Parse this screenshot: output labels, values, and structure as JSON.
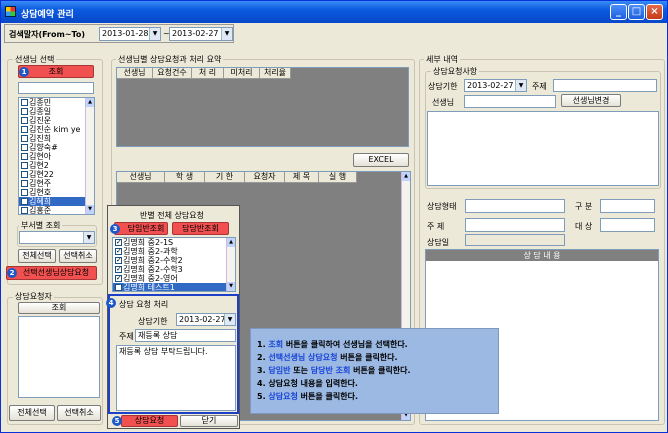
{
  "window": {
    "title": "상담예약 관리"
  },
  "search": {
    "label": "검색말자(From~To)",
    "from": "2013-01-28",
    "sep": "~",
    "to": "2013-02-27"
  },
  "teacher_select": {
    "title": "선생님 선택",
    "query_button": "조회",
    "teachers": [
      {
        "name": "김종민",
        "checked": false,
        "selected": false
      },
      {
        "name": "김종일",
        "checked": false,
        "selected": false
      },
      {
        "name": "김진운",
        "checked": false,
        "selected": false
      },
      {
        "name": "김진순 kim ye",
        "checked": false,
        "selected": false
      },
      {
        "name": "김진희",
        "checked": false,
        "selected": false
      },
      {
        "name": "김향숙#",
        "checked": false,
        "selected": false
      },
      {
        "name": "김현아",
        "checked": false,
        "selected": false
      },
      {
        "name": "김현2",
        "checked": false,
        "selected": false
      },
      {
        "name": "김현22",
        "checked": false,
        "selected": false
      },
      {
        "name": "김현주",
        "checked": false,
        "selected": false
      },
      {
        "name": "김현호",
        "checked": false,
        "selected": false
      },
      {
        "name": "김혜희",
        "checked": true,
        "selected": true
      },
      {
        "name": "김홍준",
        "checked": false,
        "selected": false
      }
    ],
    "dept_label": "부서별 조회",
    "select_all": "전체선택",
    "deselect_all": "선택취소",
    "request_button": "선택선생님상담요청"
  },
  "requester": {
    "title": "상담요청자",
    "query_button": "조회",
    "select_all": "전체선택",
    "deselect_all": "선택취소"
  },
  "summary": {
    "title": "선생님별 상담요청과 처리 요약",
    "columns": [
      "선생님",
      "요청건수",
      "처 리",
      "미처리",
      "처리율"
    ],
    "excel_button": "EXCEL",
    "detail_columns": [
      "선생님",
      "학 생",
      "기 한",
      "요청자",
      "제 목",
      "실 행"
    ]
  },
  "class_popup": {
    "title": "반별 전체 상담요청",
    "tab_homeroom": "담임반조회",
    "tab_subject": "담당반조회",
    "classes": [
      {
        "name": "김명희 중2-1S",
        "checked": true,
        "selected": false
      },
      {
        "name": "김명희 중2-과학",
        "checked": true,
        "selected": false
      },
      {
        "name": "김명희 중2-수학2",
        "checked": true,
        "selected": false
      },
      {
        "name": "김명희 중2-수학3",
        "checked": true,
        "selected": false
      },
      {
        "name": "김명희 중2-영어",
        "checked": true,
        "selected": false
      },
      {
        "name": "김명희 테스트1",
        "checked": true,
        "selected": true
      }
    ],
    "process_title": "상담 요청 처리",
    "deadline_label": "상담기한",
    "deadline_value": "2013-02-27",
    "subject_label": "주제",
    "subject_value": "재등록 상담",
    "body_text": "재등록 상담 부탁드립니다.",
    "request_button": "상담요청",
    "close_button": "닫기"
  },
  "detail": {
    "title": "세부 내역",
    "request_group": "상담요청사항",
    "deadline_label": "상담기한",
    "deadline_value": "2013-02-27",
    "subject_label": "주제",
    "teacher_label": "선생님",
    "change_teacher_button": "선생님변경",
    "form_label": "상담형태",
    "type_label": "구 분",
    "title_label": "주    제",
    "target_label": "대 상",
    "date_label": "상담일",
    "content_header": "상 담 내 용"
  },
  "help": {
    "steps": [
      {
        "num": "1.",
        "hl": "조회",
        "rest": " 버튼을 클릭하여 선생님을 선택한다."
      },
      {
        "num": "2.",
        "hl": "선택선생님 상담요청",
        "rest": " 버튼을 클릭한다."
      },
      {
        "num": "3.",
        "hl": "담임반",
        "mid": " 또는 ",
        "hl2": "담당반 조회",
        "rest": " 버튼을 클릭한다."
      },
      {
        "num": "4.",
        "hl": "",
        "rest": "상담요청 내용을 입력한다."
      },
      {
        "num": "5.",
        "hl": "상담요청",
        "rest": " 버튼을 클릭한다."
      }
    ]
  },
  "badges": [
    "1",
    "2",
    "3",
    "4",
    "5"
  ]
}
